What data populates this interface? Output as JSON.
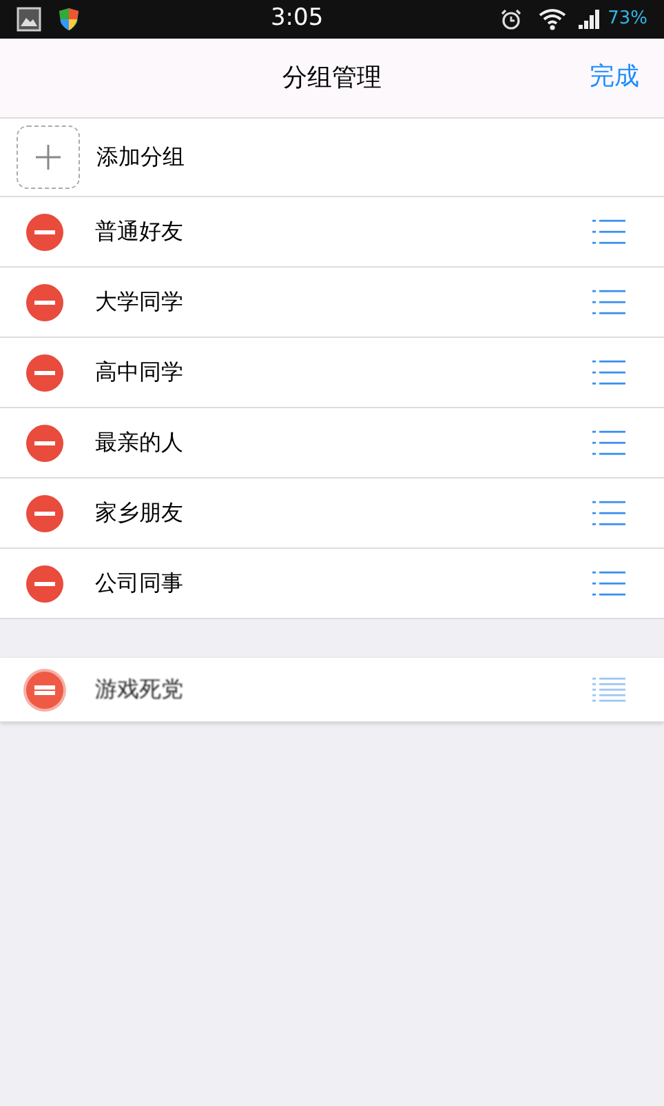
{
  "status_bar": {
    "time": "3:05",
    "battery": "73%"
  },
  "header": {
    "title": "分组管理",
    "done": "完成"
  },
  "add_row": {
    "label": "添加分组"
  },
  "groups": [
    {
      "name": "普通好友",
      "dragging": false
    },
    {
      "name": "大学同学",
      "dragging": false
    },
    {
      "name": "高中同学",
      "dragging": false
    },
    {
      "name": "最亲的人",
      "dragging": false
    },
    {
      "name": "家乡朋友",
      "dragging": false
    },
    {
      "name": "公司同事",
      "dragging": false
    },
    {
      "name": "游戏死党",
      "dragging": true
    }
  ]
}
